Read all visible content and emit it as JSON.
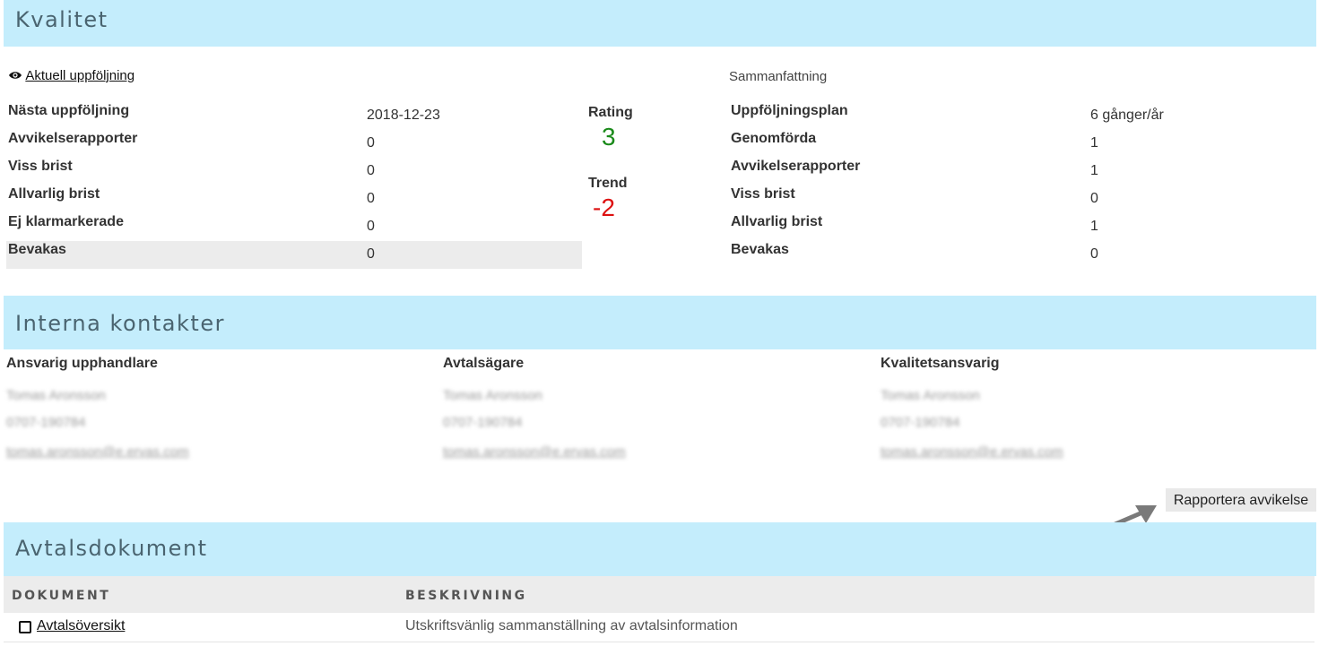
{
  "quality": {
    "title": "Kvalitet",
    "current_followup_link": "Aktuell uppföljning",
    "rows": [
      {
        "label": "Nästa uppföljning",
        "value": "2018-12-23"
      },
      {
        "label": "Avvikelserapporter",
        "value": "0"
      },
      {
        "label": "Viss brist",
        "value": "0"
      },
      {
        "label": "Allvarlig brist",
        "value": "0"
      },
      {
        "label": "Ej klarmarkerade",
        "value": "0"
      },
      {
        "label": "Bevakas",
        "value": "0"
      }
    ],
    "rating_label": "Rating",
    "rating_value": "3",
    "trend_label": "Trend",
    "trend_value": "-2",
    "summary_label": "Sammanfattning",
    "summary_rows": [
      {
        "label": "Uppföljningsplan",
        "value": "6 gånger/år"
      },
      {
        "label": "Genomförda",
        "value": "1"
      },
      {
        "label": "Avvikelserapporter",
        "value": "1"
      },
      {
        "label": "Viss brist",
        "value": "0"
      },
      {
        "label": "Allvarlig brist",
        "value": "1"
      },
      {
        "label": "Bevakas",
        "value": "0"
      }
    ],
    "colors": {
      "rating": "#1a8a1a",
      "trend": "#dd1111"
    }
  },
  "contacts": {
    "title": "Interna kontakter",
    "columns": [
      {
        "title": "Ansvarig upphandlare",
        "name": "Tomas Aronsson",
        "phone": "0707-190784",
        "email": "tomas.aronsson@e.ervas.com"
      },
      {
        "title": "Avtalsägare",
        "name": "Tomas Aronsson",
        "phone": "0707-190784",
        "email": "tomas.aronsson@e.ervas.com"
      },
      {
        "title": "Kvalitetsansvarig",
        "name": "Tomas Aronsson",
        "phone": "0707-190784",
        "email": "tomas.aronsson@e.ervas.com"
      }
    ],
    "report_button": "Rapportera avvikelse"
  },
  "documents": {
    "title": "Avtalsdokument",
    "headers": {
      "document": "DOKUMENT",
      "description": "BESKRIVNING"
    },
    "rows": [
      {
        "document": "Avtalsöversikt",
        "description": "Utskriftsvänlig sammanställning av avtalsinformation"
      }
    ]
  }
}
